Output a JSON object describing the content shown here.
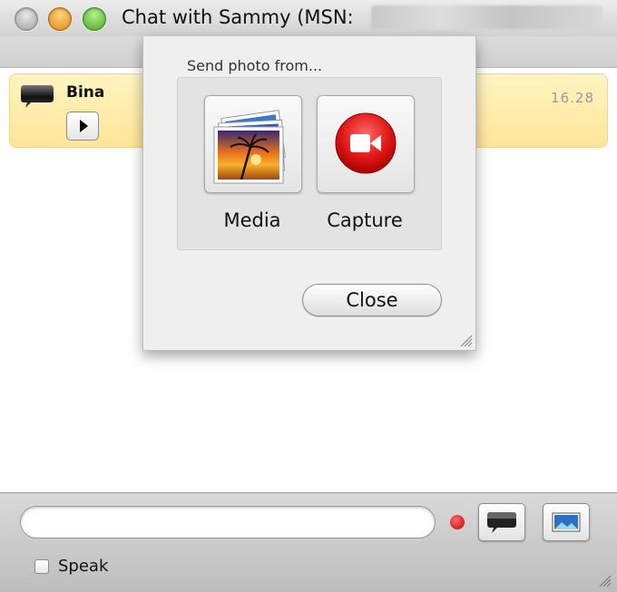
{
  "window": {
    "title": "Chat with Sammy (MSN:"
  },
  "chat": {
    "messages": [
      {
        "sender": "Bina",
        "time": "16.28"
      }
    ]
  },
  "popover": {
    "heading": "Send photo from...",
    "options": [
      {
        "label": "Media",
        "icon": "photo-stack-icon"
      },
      {
        "label": "Capture",
        "icon": "video-camera-icon"
      }
    ],
    "close_label": "Close"
  },
  "bottombar": {
    "input_value": "",
    "speak_label": "Speak",
    "speak_checked": false
  },
  "colors": {
    "message_bubble": "#ffe597",
    "record_dot": "#d40000",
    "capture_red": "#e02020"
  }
}
